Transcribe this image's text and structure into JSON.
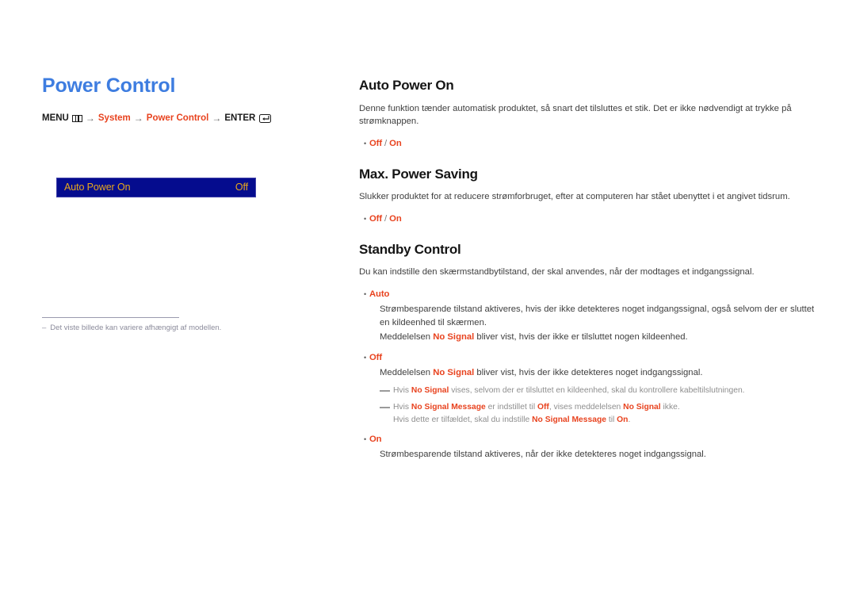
{
  "page": {
    "title": "Power Control",
    "menu_path": {
      "menu_label": "MENU",
      "menu_icon": "menu-grid-icon",
      "segments": [
        "System",
        "Power Control"
      ],
      "enter_label": "ENTER",
      "enter_icon": "enter-key-icon",
      "arrow": "→"
    },
    "osd": {
      "label": "Auto Power On",
      "value": "Off",
      "bg_color": "#050c8e",
      "text_color": "#e8a81c"
    },
    "footnote": {
      "dash": "–",
      "text": "Det viste billede kan variere afhængigt af modellen."
    },
    "title_color": "#3e7de0",
    "accent_color": "#e8431f"
  },
  "sections": [
    {
      "id": "auto-power-on",
      "heading": "Auto Power On",
      "intro": "Denne funktion tænder automatisk produktet, så snart det tilsluttes et stik. Det er ikke nødvendigt at trykke på strømknappen.",
      "options": [
        {
          "term_a": "Off",
          "sep": " / ",
          "term_b": "On"
        }
      ]
    },
    {
      "id": "max-power-saving",
      "heading": "Max. Power Saving",
      "intro": "Slukker produktet for at reducere strømforbruget, efter at computeren har stået ubenyttet i et angivet tidsrum.",
      "options": [
        {
          "term_a": "Off",
          "sep": " / ",
          "term_b": "On"
        }
      ]
    },
    {
      "id": "standby-control",
      "heading": "Standby Control",
      "intro": "Du kan indstille den skærmstandbytilstand, der skal anvendes, når der modtages et indgangssignal."
    }
  ],
  "standby_items": {
    "auto": {
      "term": "Auto",
      "para1": "Strømbesparende tilstand aktiveres, hvis der ikke detekteres noget indgangssignal, også selvom der er sluttet en kildeenhed til skærmen.",
      "para2_pre": "Meddelelsen ",
      "para2_hl": "No Signal",
      "para2_post": " bliver vist, hvis der ikke er tilsluttet nogen kildeenhed."
    },
    "off": {
      "term": "Off",
      "para1_pre": "Meddelelsen ",
      "para1_hl": "No Signal",
      "para1_post": " bliver vist, hvis der ikke detekteres noget indgangssignal.",
      "note1_pre": "Hvis ",
      "note1_hl": "No Signal",
      "note1_post": " vises, selvom der er tilsluttet en kildeenhed, skal du kontrollere kabeltilslutningen.",
      "note2_a": "Hvis ",
      "note2_hl1": "No Signal Message",
      "note2_b": " er indstillet til ",
      "note2_hl2": "Off",
      "note2_c": ", vises meddelelsen ",
      "note2_hl3": "No Signal",
      "note2_d": " ikke.",
      "note2_cont_a": "Hvis dette er tilfældet, skal du indstille ",
      "note2_cont_hl1": "No Signal Message",
      "note2_cont_b": " til ",
      "note2_cont_hl2": "On",
      "note2_cont_c": "."
    },
    "on": {
      "term": "On",
      "para1": "Strømbesparende tilstand aktiveres, når der ikke detekteres noget indgangssignal."
    }
  },
  "symbols": {
    "bullet": "•",
    "arrow": "→"
  }
}
